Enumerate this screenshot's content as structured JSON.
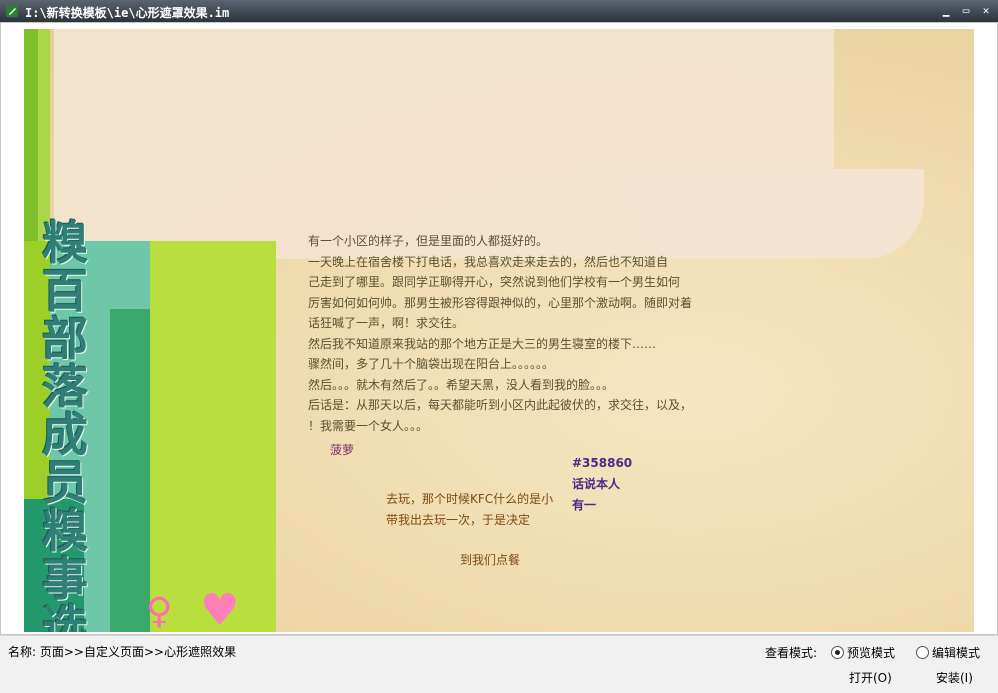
{
  "window": {
    "title": "I:\\新转换模板\\ie\\心形遮罩效果.im",
    "app_icon": "pencil-icon",
    "controls": {
      "minimize": "▁",
      "maximize": "▭",
      "close": "✕"
    }
  },
  "preview": {
    "vertical_title": [
      "糗",
      "百",
      "部",
      "落",
      "成",
      "员",
      "糗",
      "事",
      "选"
    ],
    "story_lines": [
      "有一个小区的样子，但是里面的人都挺好的。",
      "一天晚上在宿舍楼下打电话，我总喜欢走来走去的，然后也不知道自",
      "己走到了哪里。跟同学正聊得开心，突然说到他们学校有一个男生如何",
      "厉害如何如何帅。那男生被形容得跟神似的，心里那个激动啊。随即对着",
      "话狂喊了一声，啊！求交往。",
      "然后我不知道原来我站的那个地方正是大三的男生寝室的楼下……",
      "骤然间，多了几十个脑袋出现在阳台上。。。。。。",
      "然后。。。就木有然后了。。希望天黑，没人看到我的脸。。。",
      "后话是：从那天以后，每天都能听到小区内此起彼伏的，求交往，以及，",
      "！我需要一个女人。。。"
    ],
    "signature": "菠萝",
    "middle_left": [
      "去玩，那个时候KFC什么的是小",
      "带我出去玩一次，于是决定"
    ],
    "middle_right": [
      "#358860",
      "话说本人",
      "有一"
    ],
    "bottom_note": "到我们点餐"
  },
  "status": {
    "path": "名称: 页面>>自定义页面>>心形遮照效果",
    "view_mode_label": "查看模式:",
    "radio_preview": "预览模式",
    "radio_edit": "编辑模式",
    "open_button": "打开(O)",
    "install_button": "安装(I)",
    "selected_mode": "预览模式"
  }
}
